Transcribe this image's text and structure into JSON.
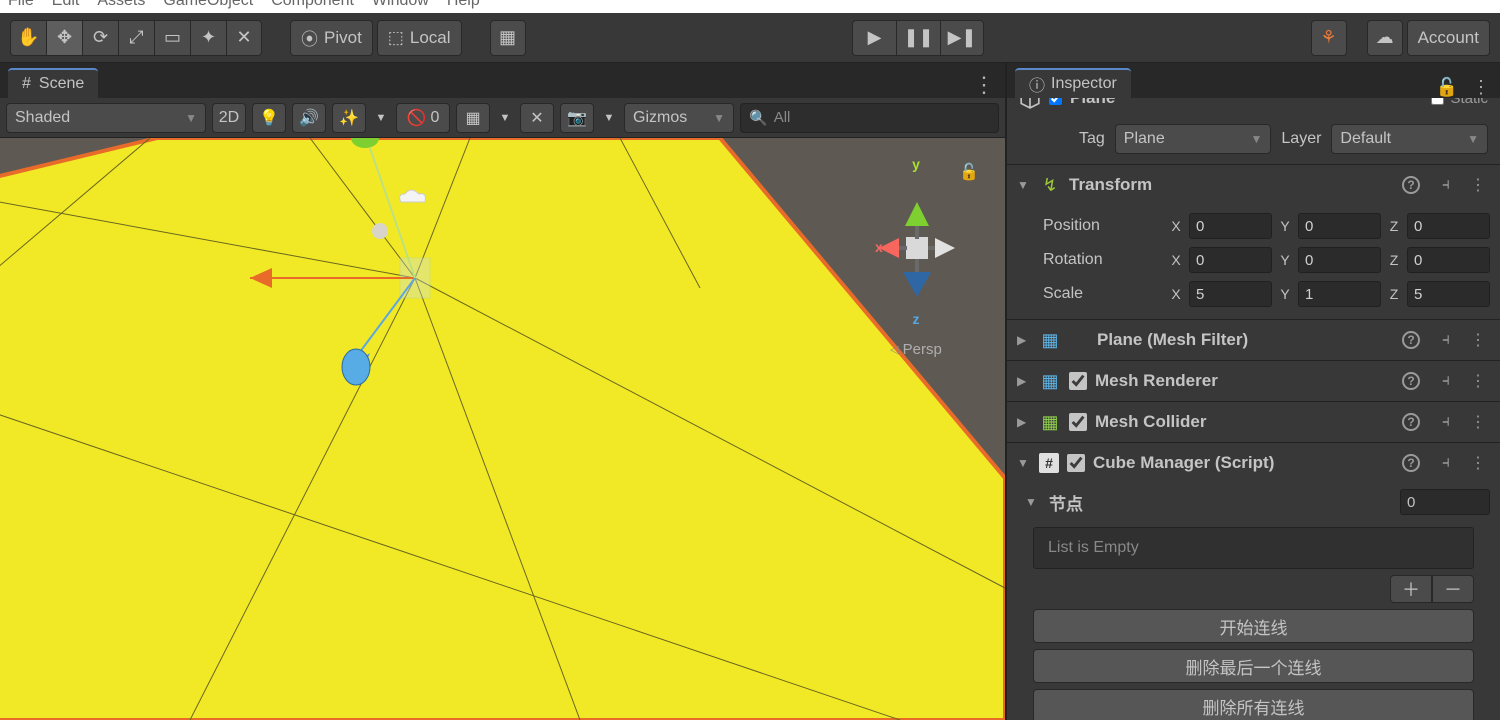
{
  "menubar": [
    "File",
    "Edit",
    "Assets",
    "GameObject",
    "Component",
    "Window",
    "Help"
  ],
  "toolbar": {
    "pivot": "Pivot",
    "local": "Local",
    "account": "Account"
  },
  "sceneTab": {
    "label": "Scene"
  },
  "sceneToolbar": {
    "shaded": "Shaded",
    "mode2d": "2D",
    "visOff": "0",
    "gizmos": "Gizmos",
    "searchPlaceholder": "All"
  },
  "gizmo3d": {
    "x": "x",
    "y": "y",
    "z": "z",
    "persp": "Persp"
  },
  "inspector": {
    "tabLabel": "Inspector",
    "objectName": "Plane",
    "staticLabel": "Static",
    "tagLabel": "Tag",
    "tagValue": "Plane",
    "layerLabel": "Layer",
    "layerValue": "Default"
  },
  "transform": {
    "title": "Transform",
    "positionLabel": "Position",
    "rotationLabel": "Rotation",
    "scaleLabel": "Scale",
    "position": {
      "x": "0",
      "y": "0",
      "z": "0"
    },
    "rotation": {
      "x": "0",
      "y": "0",
      "z": "0"
    },
    "scale": {
      "x": "5",
      "y": "1",
      "z": "5"
    }
  },
  "components": {
    "meshFilter": "Plane (Mesh Filter)",
    "meshRenderer": "Mesh Renderer",
    "meshCollider": "Mesh Collider",
    "cubeManager": "Cube Manager (Script)"
  },
  "list": {
    "label": "节点",
    "count": "0",
    "empty": "List is Empty"
  },
  "buttons": {
    "start": "开始连线",
    "delLast": "删除最后一个连线",
    "delAll": "删除所有连线"
  }
}
